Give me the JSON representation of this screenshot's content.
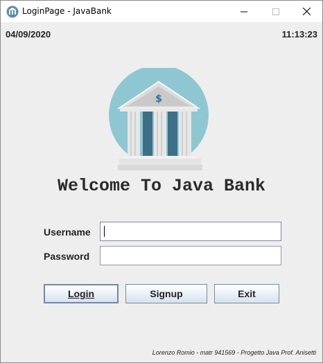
{
  "window": {
    "title": "LoginPage - JavaBank",
    "controls": {
      "minimize": "minimize-icon",
      "maximize": "maximize-icon",
      "close": "close-icon"
    }
  },
  "header": {
    "date": "04/09/2020",
    "time": "11:13:23"
  },
  "logo": {
    "icon": "bank-icon",
    "circle_color": "#8ec7d2",
    "column_color": "#3e6f88"
  },
  "welcome": "Welcome To Java Bank",
  "form": {
    "username_label": "Username",
    "username_value": "",
    "password_label": "Password",
    "password_value": ""
  },
  "buttons": {
    "login": "Login",
    "signup": "Signup",
    "exit": "Exit"
  },
  "footer": {
    "credits": "Lorenzo Romio - matr 941569 - Progetto Java Prof. Anisetti"
  }
}
